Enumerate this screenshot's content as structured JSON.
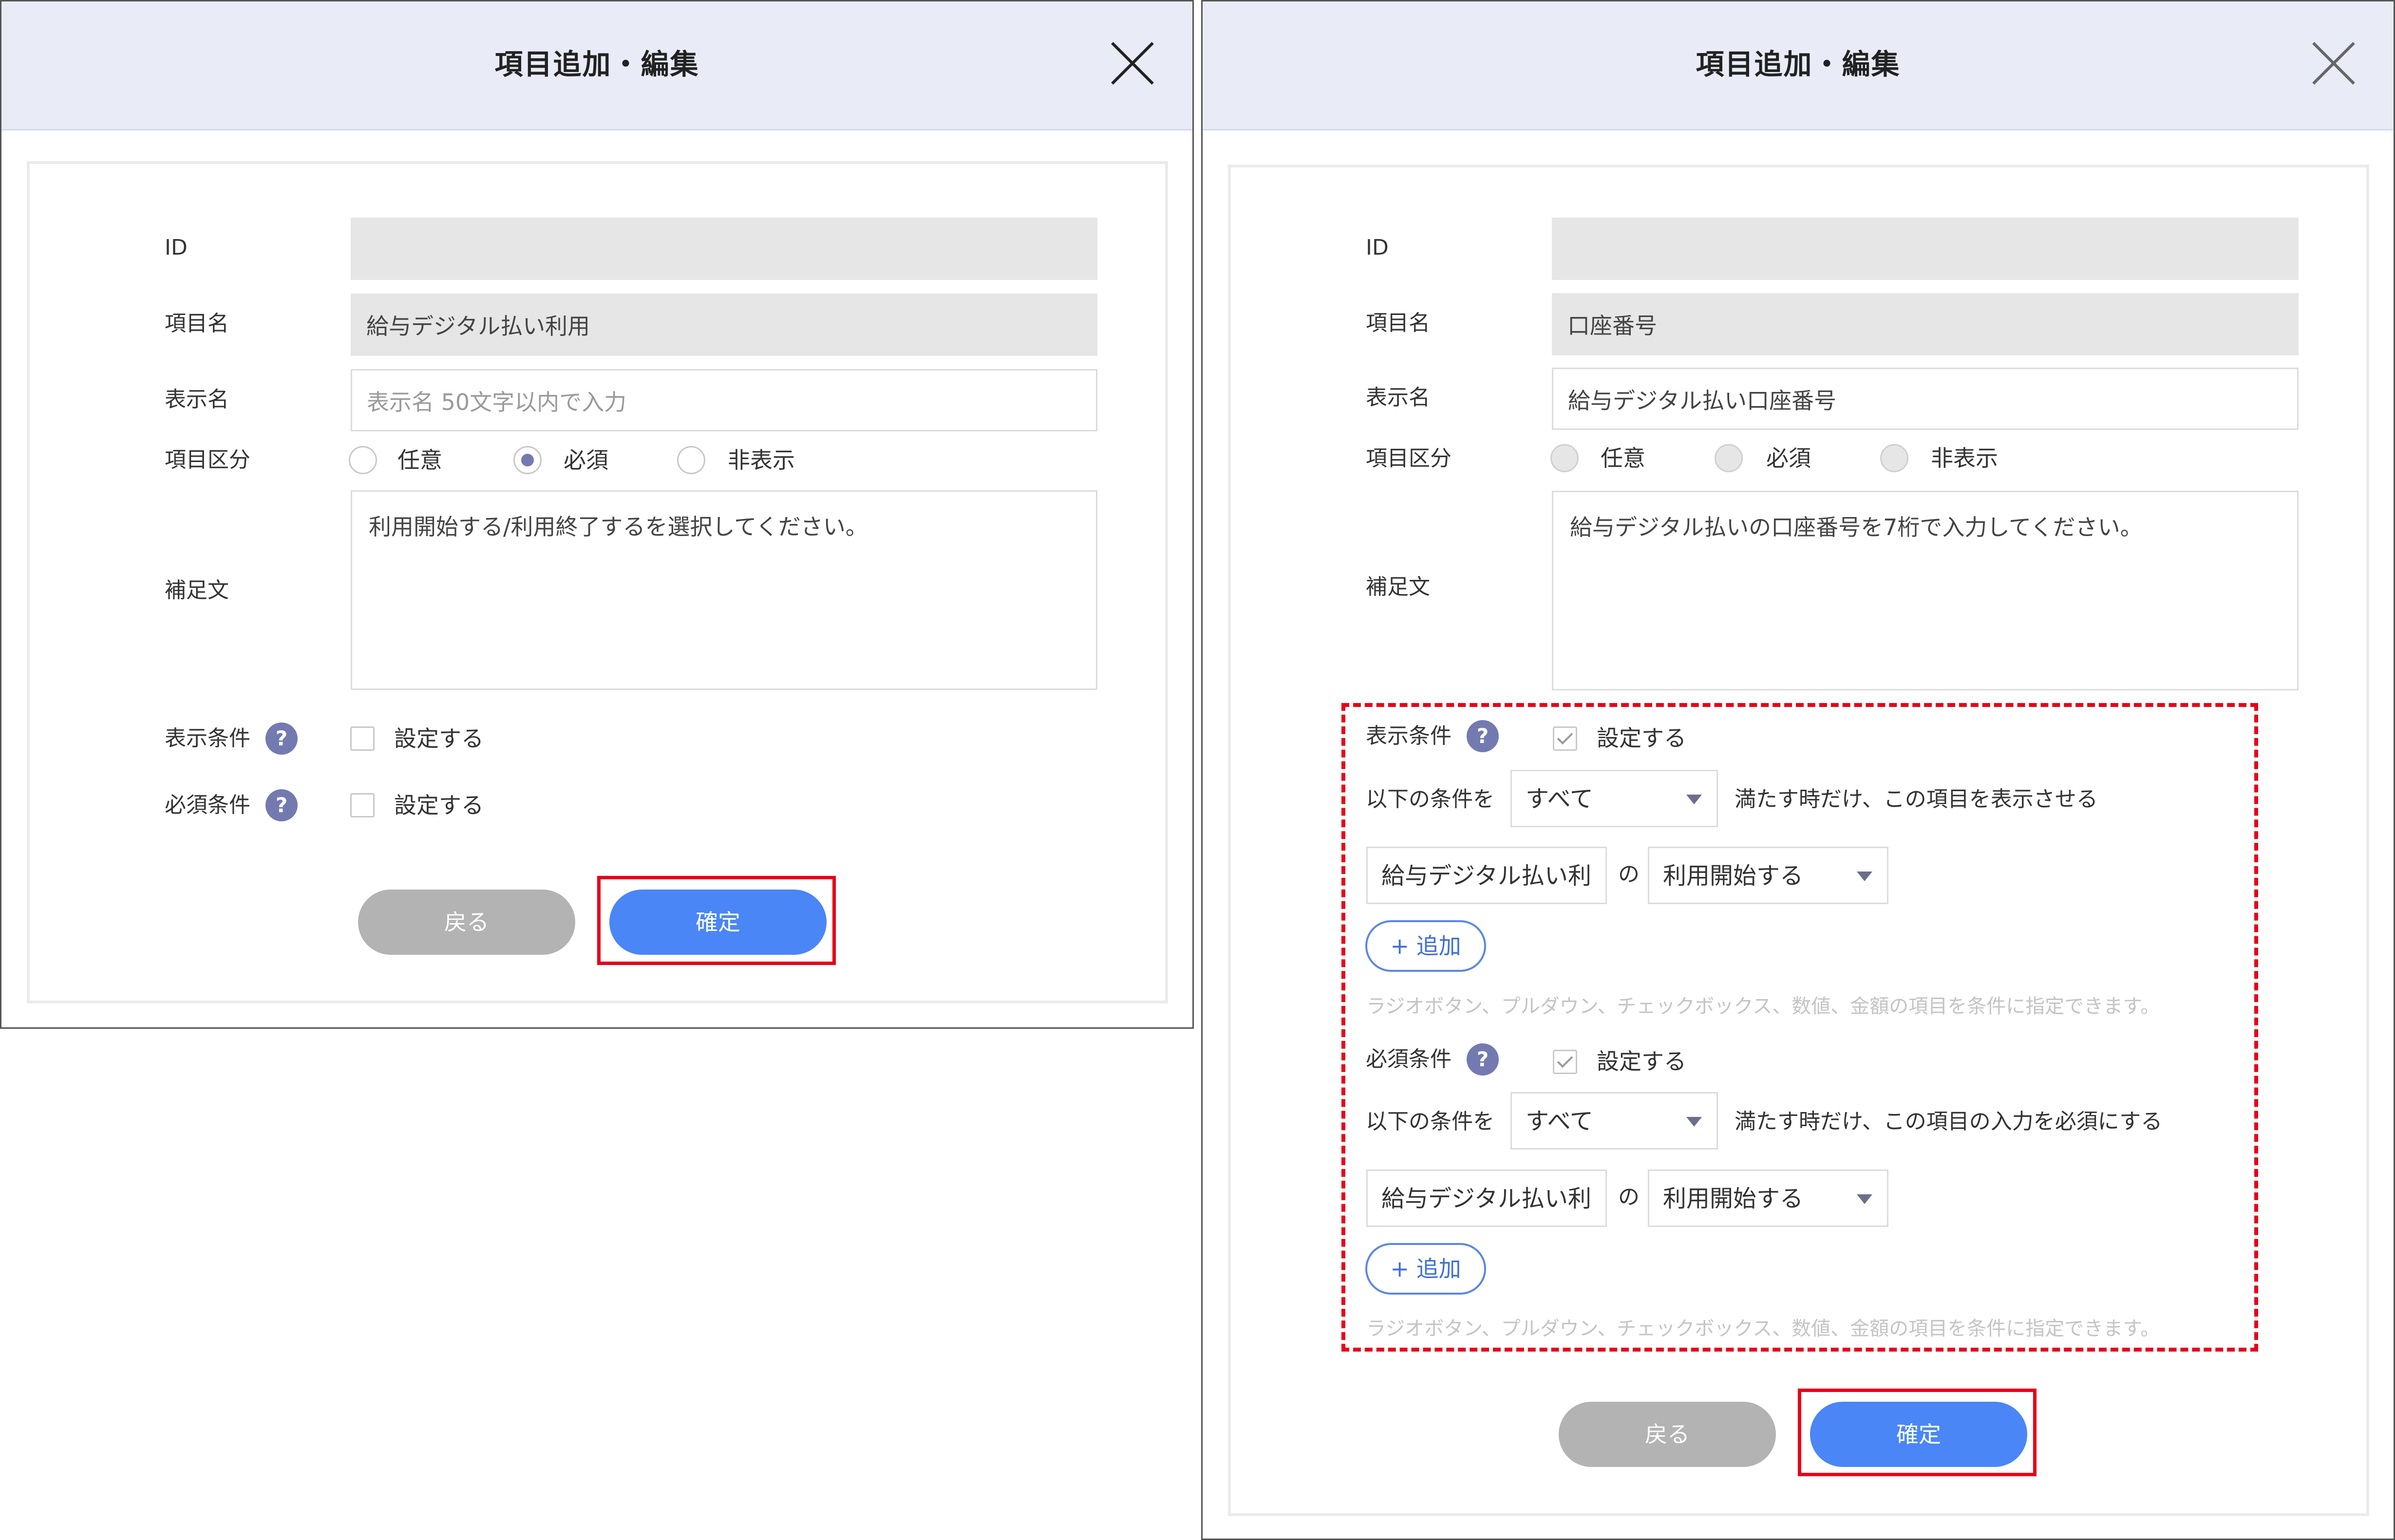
{
  "common": {
    "title": "項目追加・編集",
    "labels": {
      "id": "ID",
      "item_name": "項目名",
      "display_name": "表示名",
      "category": "項目区分",
      "note": "補足文",
      "display_condition": "表示条件",
      "required_condition": "必須条件"
    },
    "radio_options": [
      "任意",
      "必須",
      "非表示"
    ],
    "checkbox_label": "設定する",
    "help_icon": "question-icon",
    "help_glyph": "?",
    "back_label": "戻る",
    "confirm_label": "確定"
  },
  "dialog1": {
    "id_value": "",
    "item_name_value": "給与デジタル払い利用",
    "display_name_placeholder": "表示名 50文字以内で入力",
    "category_selected": "必須",
    "note_value": "利用開始する/利用終了するを選択してください。",
    "display_condition_checked": false,
    "required_condition_checked": false
  },
  "dialog2": {
    "id_value": "",
    "item_name_value": "口座番号",
    "display_name_value": "給与デジタル払い口座番号",
    "category_selected": "",
    "note_value": "給与デジタル払いの口座番号を7桁で入力してください。",
    "display_condition": {
      "checked": true,
      "prefix": "以下の条件を",
      "match_select": "すべて",
      "suffix": "満たす時だけ、この項目を表示させる",
      "rule_item": "給与デジタル払い利",
      "rule_joiner": "の",
      "rule_value": "利用開始する",
      "add_label": "+ 追加",
      "hint": "ラジオボタン、プルダウン、チェックボックス、数値、金額の項目を条件に指定できます。"
    },
    "required_condition": {
      "checked": true,
      "prefix": "以下の条件を",
      "match_select": "すべて",
      "suffix": "満たす時だけ、この項目の入力を必須にする",
      "rule_item": "給与デジタル払い利",
      "rule_joiner": "の",
      "rule_value": "利用開始する",
      "add_label": "+ 追加",
      "hint": "ラジオボタン、プルダウン、チェックボックス、数値、金額の項目を条件に指定できます。"
    }
  },
  "annotation_color": "#e8001a",
  "accent_color": "#4a86f5"
}
